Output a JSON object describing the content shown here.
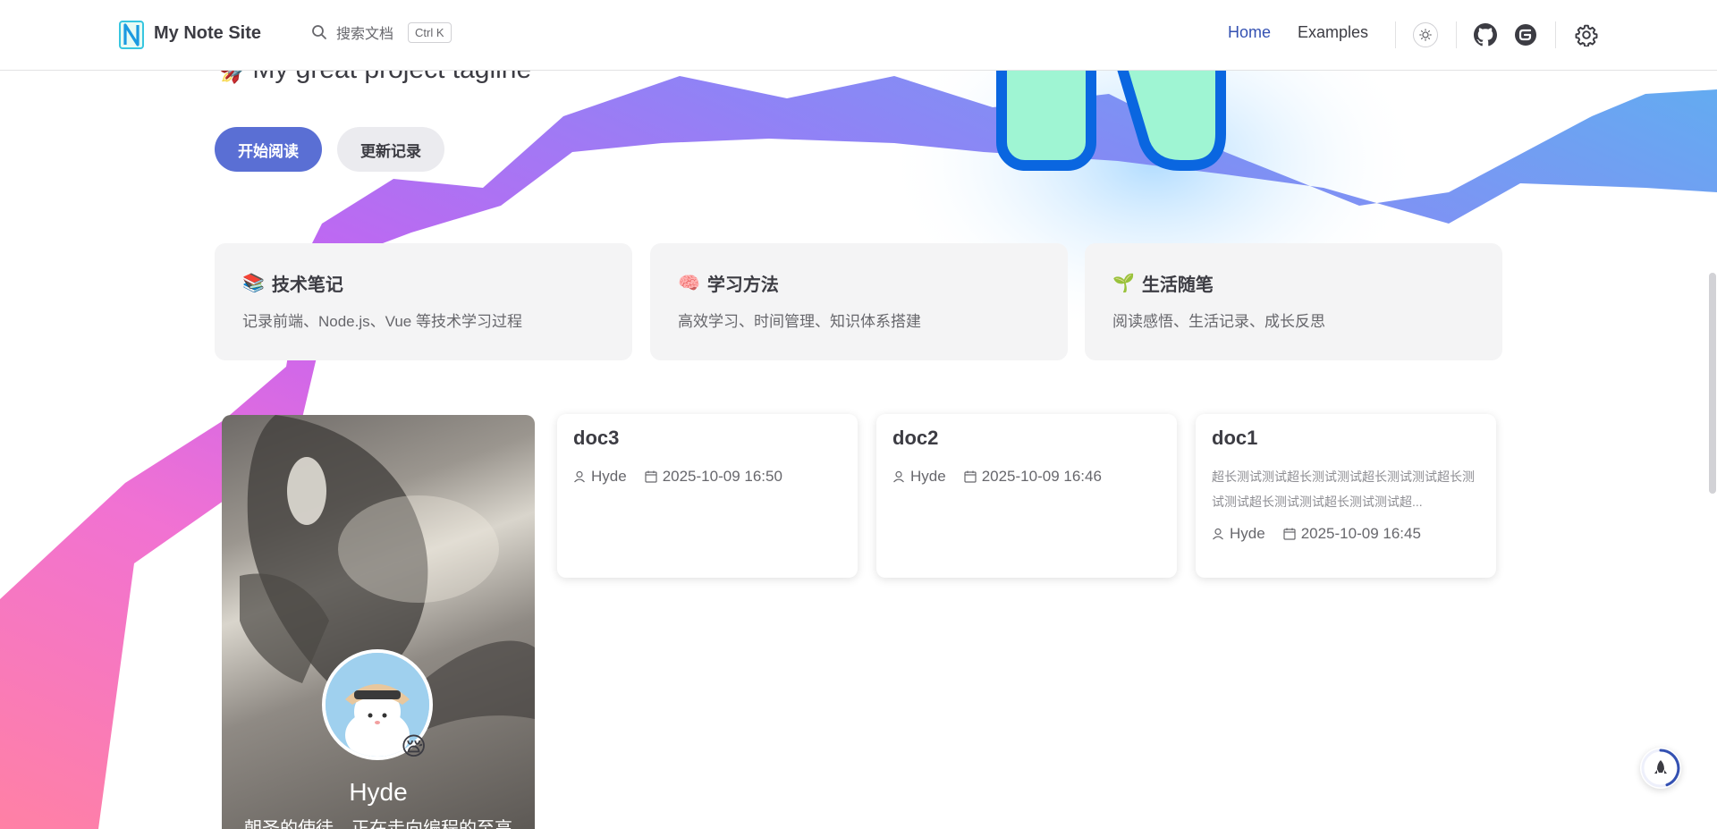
{
  "nav": {
    "site_title": "My Note Site",
    "search_placeholder": "搜索文档",
    "search_shortcut": "Ctrl K",
    "links": [
      {
        "label": "Home",
        "active": true
      },
      {
        "label": "Examples",
        "active": false
      }
    ],
    "icons": [
      "sun-icon",
      "github-icon",
      "g-icon",
      "gear-icon"
    ]
  },
  "hero": {
    "tagline": "My great project tagline",
    "actions": [
      {
        "label": "开始阅读"
      },
      {
        "label": "更新记录"
      }
    ]
  },
  "features": [
    {
      "emoji": "📚",
      "title": "技术笔记",
      "desc": "记录前端、Node.js、Vue 等技术学习过程"
    },
    {
      "emoji": "🧠",
      "title": "学习方法",
      "desc": "高效学习、时间管理、知识体系搭建"
    },
    {
      "emoji": "🌱",
      "title": "生活随笔",
      "desc": "阅读感悟、生活记录、成长反思"
    }
  ],
  "profile": {
    "name": "Hyde",
    "bio": "朝圣的使徒，正在走向编程的至高",
    "badge": "😪"
  },
  "docs": [
    {
      "title": "doc3",
      "excerpt": "",
      "author": "Hyde",
      "date": "2025-10-09 16:50"
    },
    {
      "title": "doc2",
      "excerpt": "",
      "author": "Hyde",
      "date": "2025-10-09 16:46"
    },
    {
      "title": "doc1",
      "excerpt": "超长测试测试超长测试测试超长测试测试超长测试测试超长测试测试超长测试测试超...",
      "author": "Hyde",
      "date": "2025-10-09 16:45"
    }
  ],
  "colors": {
    "accent": "#3451b2",
    "button": "#5a6fd4"
  }
}
